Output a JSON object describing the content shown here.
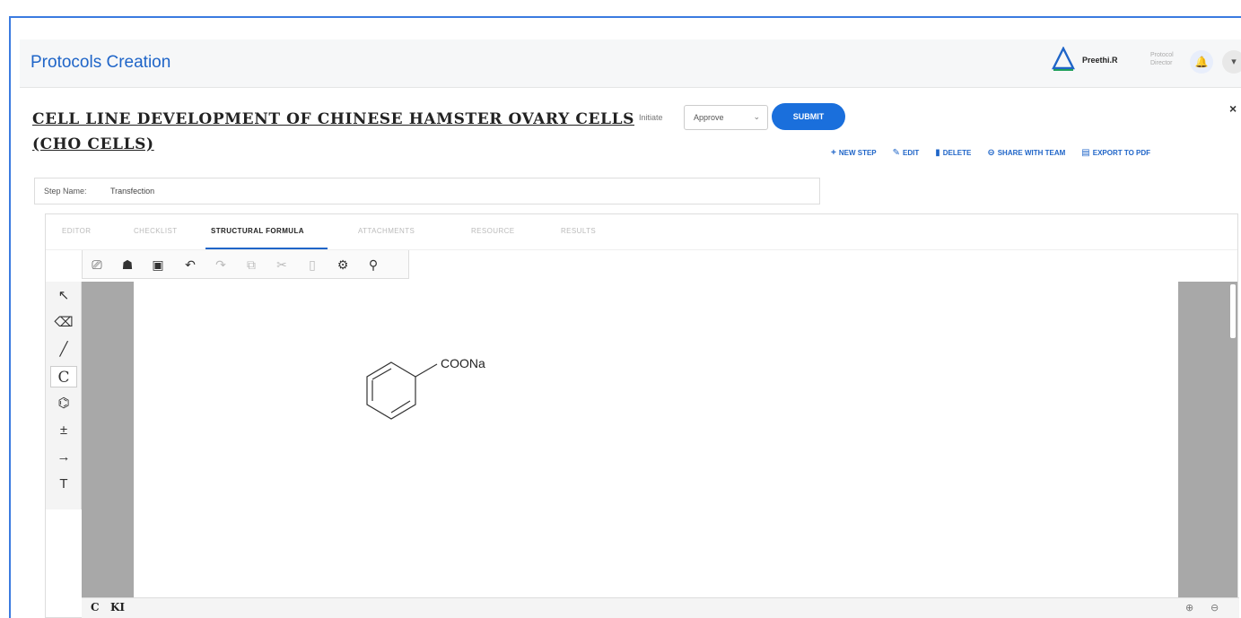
{
  "app": {
    "title": "Protocols Creation"
  },
  "user": {
    "name": "Preethi.R",
    "role": "Protocol Director"
  },
  "protocol": {
    "title": "CELL LINE DEVELOPMENT OF CHINESE HAMSTER OVARY CELLS (CHO CELLS)",
    "initiate_label": "Initiate",
    "status_selected": "Approve",
    "submit_label": "SUBMIT",
    "close_label": "×"
  },
  "actions": [
    {
      "label": "NEW STEP",
      "icon": "plus-icon",
      "glyph": "+"
    },
    {
      "label": "EDIT",
      "icon": "pencil-icon",
      "glyph": "✎"
    },
    {
      "label": "DELETE",
      "icon": "trash-icon",
      "glyph": "▮"
    },
    {
      "label": "SHARE WITH TEAM",
      "icon": "share-icon",
      "glyph": "⊖"
    },
    {
      "label": "EXPORT TO PDF",
      "icon": "pdf-icon",
      "glyph": "▤"
    }
  ],
  "step": {
    "label": "Step Name:",
    "value": "Transfection"
  },
  "tabs": [
    {
      "label": "EDITOR"
    },
    {
      "label": "CHECKLIST"
    },
    {
      "label": "STRUCTURAL FORMULA"
    },
    {
      "label": "ATTACHMENTS"
    },
    {
      "label": "RESOURCE"
    },
    {
      "label": "RESULTS"
    }
  ],
  "toolbar": [
    {
      "name": "new-document-icon",
      "glyph": "⎚"
    },
    {
      "name": "open-icon",
      "glyph": "☗"
    },
    {
      "name": "save-icon",
      "glyph": "▣"
    },
    {
      "name": "undo-icon",
      "glyph": "↶"
    },
    {
      "name": "redo-icon",
      "glyph": "↷"
    },
    {
      "name": "copy-icon",
      "glyph": "⧉"
    },
    {
      "name": "cut-icon",
      "glyph": "✂"
    },
    {
      "name": "paste-icon",
      "glyph": "▯"
    },
    {
      "name": "settings-icon",
      "glyph": "⚙"
    },
    {
      "name": "zoom-icon",
      "glyph": "⚲"
    }
  ],
  "left_tools": [
    {
      "name": "select-arrow-icon",
      "glyph": "↖"
    },
    {
      "name": "eraser-icon",
      "glyph": "⌫"
    },
    {
      "name": "bond-line-icon",
      "glyph": "╱"
    },
    {
      "name": "carbon-atom-tool",
      "glyph": "C"
    },
    {
      "name": "ring-template-icon",
      "glyph": "⌬"
    },
    {
      "name": "charge-icon",
      "glyph": "±"
    },
    {
      "name": "reaction-arrow-icon",
      "glyph": "→"
    },
    {
      "name": "text-tool-icon",
      "glyph": "T"
    }
  ],
  "molecule": {
    "substituent_label": "COONa"
  },
  "bottom_bar": {
    "atom_c": "C",
    "atom_ki": "KI"
  },
  "colors": {
    "accent": "#1a6fdc",
    "frame": "#3b7be0"
  }
}
